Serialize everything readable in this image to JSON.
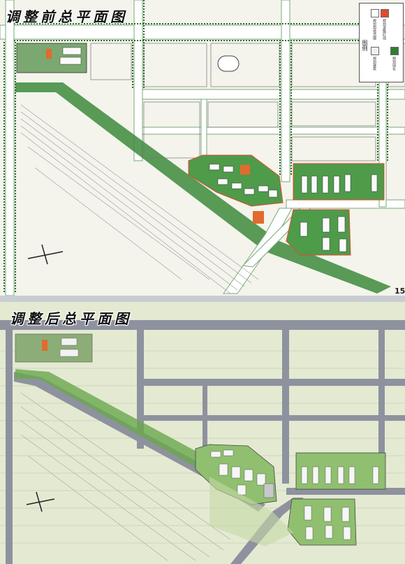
{
  "top_map": {
    "title": "调整前总平面图",
    "legend": {
      "title": "图例",
      "items": [
        {
          "label": "规划用地范围",
          "color": "#ffffff"
        },
        {
          "label": "规划道路红线",
          "color": "#e24a2a"
        },
        {
          "label": "规划建筑",
          "color": "#f0f0f0"
        },
        {
          "label": "规划绿化",
          "color": "#2e7d32"
        }
      ]
    },
    "page_marker": "15"
  },
  "bottom_map": {
    "title": "调整后总平面图"
  },
  "colors": {
    "road_top": "#ffffff",
    "road_bottom": "#8e929e",
    "greenbelt": "#2d7a2d",
    "block_outline": "#6b7d6b",
    "building_orange": "#e26a2c",
    "building_white": "#fafafa"
  }
}
